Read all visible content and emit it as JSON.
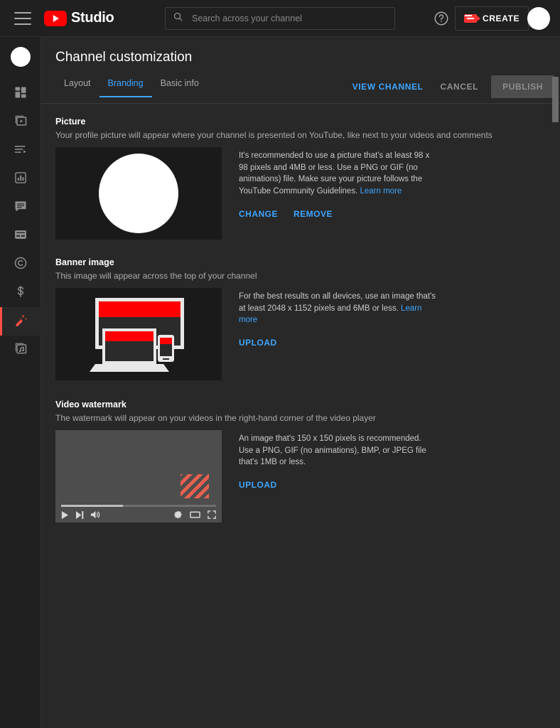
{
  "header": {
    "menu_icon": "hamburger-icon",
    "brand": "Studio",
    "logo_icon": "youtube-logo-icon",
    "search": {
      "icon": "search-icon",
      "value": "",
      "placeholder": "Search across your channel"
    },
    "help_icon": "help-circle-icon",
    "create": {
      "icon": "video-camera-plus-icon",
      "label": "CREATE"
    },
    "avatar": "account-avatar"
  },
  "sidebar": {
    "avatar": "channel-avatar",
    "items": [
      {
        "icon": "dashboard-icon",
        "name": "dashboard",
        "active": false
      },
      {
        "icon": "content-video-icon",
        "name": "content",
        "active": false
      },
      {
        "icon": "playlists-icon",
        "name": "playlists",
        "active": false
      },
      {
        "icon": "analytics-bar-chart-icon",
        "name": "analytics",
        "active": false
      },
      {
        "icon": "comments-bubble-icon",
        "name": "comments",
        "active": false
      },
      {
        "icon": "subtitles-icon",
        "name": "subtitles",
        "active": false
      },
      {
        "icon": "copyright-icon",
        "name": "copyright",
        "active": false
      },
      {
        "icon": "monetization-dollar-icon",
        "name": "earn",
        "active": false
      },
      {
        "icon": "magic-wand-icon",
        "name": "customization",
        "active": true
      },
      {
        "icon": "audio-library-icon",
        "name": "audio-library",
        "active": false
      }
    ]
  },
  "page": {
    "title": "Channel customization",
    "tabs": [
      {
        "label": "Layout",
        "active": false
      },
      {
        "label": "Branding",
        "active": true
      },
      {
        "label": "Basic info",
        "active": false
      }
    ],
    "actions": {
      "view_channel": "VIEW CHANNEL",
      "cancel": "CANCEL",
      "publish": "PUBLISH"
    }
  },
  "sections": {
    "picture": {
      "title": "Picture",
      "subtitle": "Your profile picture will appear where your channel is presented on YouTube, like next to your videos and comments",
      "description": "It's recommended to use a picture that's at least 98 x 98 pixels and 4MB or less. Use a PNG or GIF (no animations) file. Make sure your picture follows the YouTube Community Guidelines.",
      "learn_more": "Learn more",
      "buttons": [
        {
          "label": "CHANGE",
          "name": "change-picture-button"
        },
        {
          "label": "REMOVE",
          "name": "remove-picture-button"
        }
      ],
      "preview": "profile-picture-preview"
    },
    "banner": {
      "title": "Banner image",
      "subtitle": "This image will appear across the top of your channel",
      "description": "For the best results on all devices, use an image that's at least 2048 x 1152 pixels and 6MB or less.",
      "learn_more": "Learn more",
      "buttons": [
        {
          "label": "UPLOAD",
          "name": "upload-banner-button"
        }
      ],
      "preview": "banner-devices-illustration"
    },
    "watermark": {
      "title": "Video watermark",
      "subtitle": "The watermark will appear on your videos in the right-hand corner of the video player",
      "description": "An image that's 150 x 150 pixels is recommended. Use a PNG, GIF (no animations), BMP, or JPEG file that's 1MB or less.",
      "learn_more": "",
      "buttons": [
        {
          "label": "UPLOAD",
          "name": "upload-watermark-button"
        }
      ],
      "preview": "video-player-watermark-preview",
      "player_controls": {
        "play": "play-icon",
        "next": "next-track-icon",
        "volume": "volume-icon",
        "settings": "gear-icon",
        "theater": "theater-mode-icon",
        "fullscreen": "fullscreen-icon"
      }
    }
  },
  "colors": {
    "accent_blue": "#3ea6ff",
    "brand_red": "#ff0000",
    "active_red": "#ff4e45",
    "bg_main": "#282828",
    "bg_chrome": "#202020"
  }
}
